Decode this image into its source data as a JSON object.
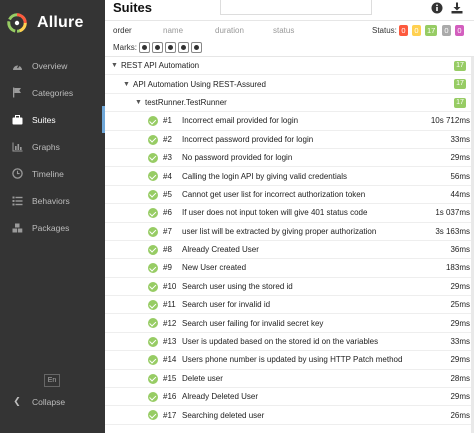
{
  "app": {
    "name": "Allure"
  },
  "sidebar": {
    "items": [
      {
        "label": "Overview",
        "icon": "dashboard-icon"
      },
      {
        "label": "Categories",
        "icon": "flag-icon"
      },
      {
        "label": "Suites",
        "icon": "briefcase-icon",
        "active": true
      },
      {
        "label": "Graphs",
        "icon": "bar-chart-icon"
      },
      {
        "label": "Timeline",
        "icon": "clock-icon"
      },
      {
        "label": "Behaviors",
        "icon": "list-icon"
      },
      {
        "label": "Packages",
        "icon": "cubes-icon"
      }
    ],
    "language": "En",
    "collapse_label": "Collapse"
  },
  "header": {
    "title": "Suites"
  },
  "sortbar": {
    "order": "order",
    "name": "name",
    "duration": "duration",
    "status": "status",
    "status_label": "Status:",
    "badges": [
      "0",
      "0",
      "17",
      "0",
      "0"
    ]
  },
  "marks": {
    "label": "Marks:"
  },
  "tree": {
    "level0": {
      "label": "REST API Automation",
      "count": "17"
    },
    "level1": {
      "label": "API Automation Using REST-Assured",
      "count": "17"
    },
    "level2": {
      "label": "testRunner.TestRunner",
      "count": "17"
    },
    "tests": [
      {
        "num": "#1",
        "name": "Incorrect email provided for login",
        "duration": "10s 712ms"
      },
      {
        "num": "#2",
        "name": "Incorrect password provided for login",
        "duration": "33ms"
      },
      {
        "num": "#3",
        "name": "No password provided for login",
        "duration": "29ms"
      },
      {
        "num": "#4",
        "name": "Calling the login API by giving valid credentials",
        "duration": "56ms"
      },
      {
        "num": "#5",
        "name": "Cannot get user list for incorrect authorization token",
        "duration": "44ms"
      },
      {
        "num": "#6",
        "name": "If user does not input token will give 401 status code",
        "duration": "1s 037ms"
      },
      {
        "num": "#7",
        "name": "user list will be extracted by giving proper authorization",
        "duration": "3s 163ms"
      },
      {
        "num": "#8",
        "name": "Already Created User",
        "duration": "36ms"
      },
      {
        "num": "#9",
        "name": "New User created",
        "duration": "183ms"
      },
      {
        "num": "#10",
        "name": "Search user using the stored id",
        "duration": "29ms"
      },
      {
        "num": "#11",
        "name": "Search user for invalid id",
        "duration": "25ms"
      },
      {
        "num": "#12",
        "name": "Search user failing for invalid secret key",
        "duration": "29ms"
      },
      {
        "num": "#13",
        "name": "User is updated based on the stored id on the variables",
        "duration": "33ms"
      },
      {
        "num": "#14",
        "name": "Users phone number is updated by using HTTP Patch method",
        "duration": "29ms"
      },
      {
        "num": "#15",
        "name": "Delete user",
        "duration": "28ms"
      },
      {
        "num": "#16",
        "name": "Already Deleted User",
        "duration": "29ms"
      },
      {
        "num": "#17",
        "name": "Searching deleted user",
        "duration": "26ms"
      }
    ]
  },
  "colors": {
    "sidebar_bg": "#343434",
    "passed": "#97cc64",
    "failed": "#fd5a3e",
    "broken": "#ffd050",
    "skipped": "#aaaaaa",
    "unknown": "#d35ebe",
    "active_indicator": "#6fa7d8"
  }
}
